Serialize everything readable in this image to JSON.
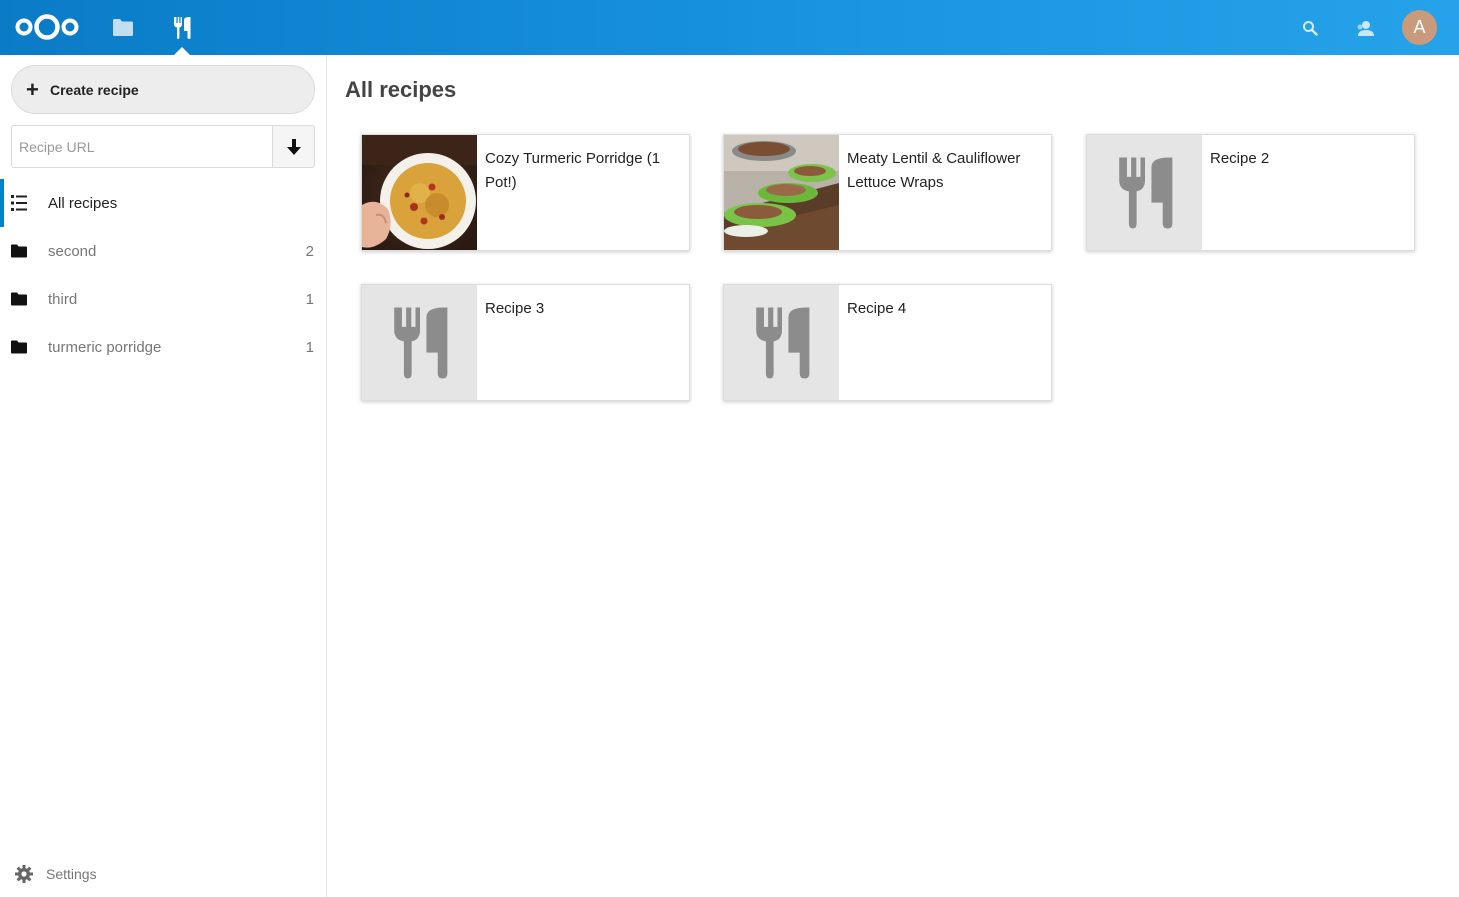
{
  "header": {
    "apps": [
      {
        "name": "Files",
        "icon": "folder-icon"
      },
      {
        "name": "Cookbook",
        "icon": "fork-knife-icon",
        "active": true
      }
    ],
    "avatar_initial": "A",
    "colors": {
      "primary": "#0082c9",
      "header_start": "#0a7bc7",
      "header_end": "#26a2ea"
    }
  },
  "sidebar": {
    "create_label": "Create recipe",
    "url_placeholder": "Recipe URL",
    "items": [
      {
        "label": "All recipes",
        "count": "",
        "icon": "list-icon",
        "active": true
      },
      {
        "label": "second",
        "count": "2",
        "icon": "folder-icon"
      },
      {
        "label": "third",
        "count": "1",
        "icon": "folder-icon"
      },
      {
        "label": "turmeric porridge",
        "count": "1",
        "icon": "folder-icon"
      }
    ],
    "settings_label": "Settings"
  },
  "main": {
    "title": "All recipes",
    "recipes": [
      {
        "title": "Cozy Turmeric Porridge (1 Pot!)",
        "image": "porridge-photo"
      },
      {
        "title": "Meaty Lentil & Cauliflower Lettuce Wraps",
        "image": "lettuce-wraps-photo"
      },
      {
        "title": "Recipe 2",
        "image": "placeholder"
      },
      {
        "title": "Recipe 3",
        "image": "placeholder"
      },
      {
        "title": "Recipe 4",
        "image": "placeholder"
      }
    ]
  }
}
